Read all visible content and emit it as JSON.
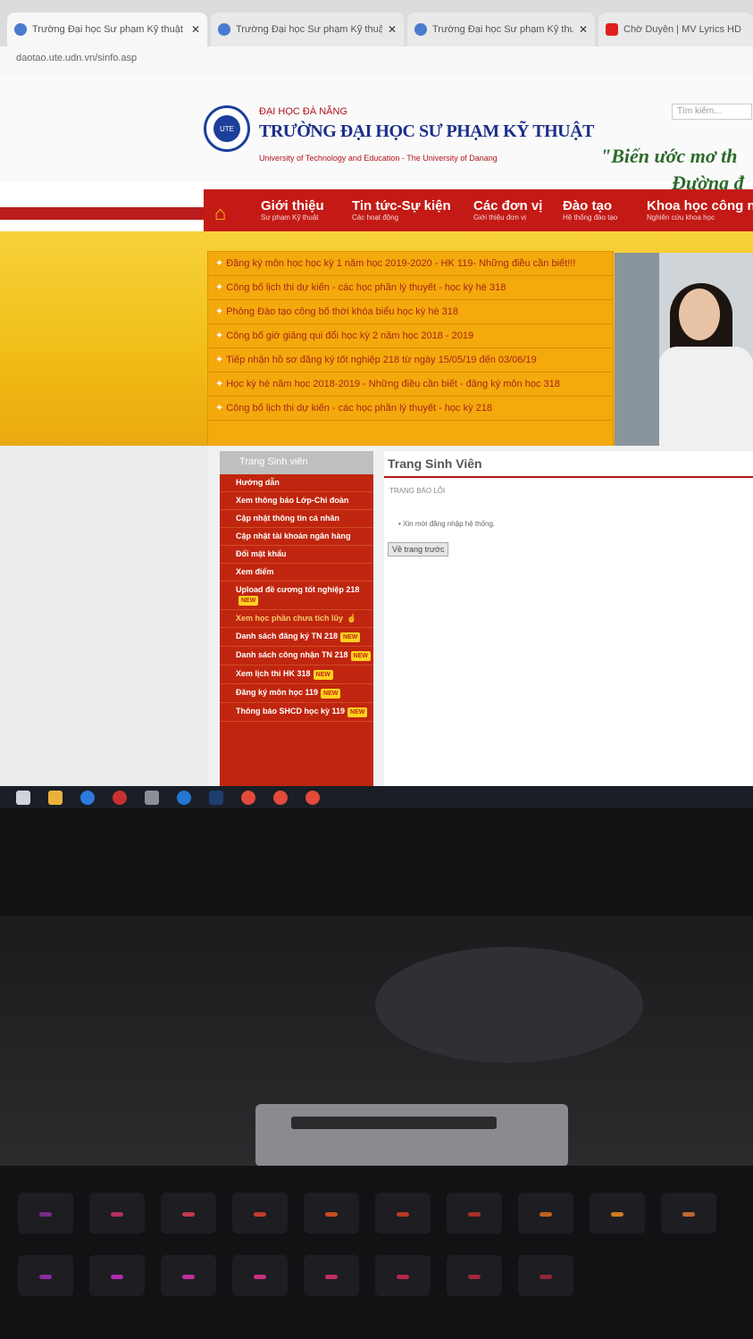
{
  "browser": {
    "tabs": [
      {
        "title": "Trường Đại học Sư phạm Kỹ thuật",
        "active": true
      },
      {
        "title": "Trường Đại học Sư phạm Kỹ thuật",
        "active": false
      },
      {
        "title": "Trường Đại học Sư phạm Kỹ thuật",
        "active": false
      },
      {
        "title": "Chờ Duyên | MV Lyrics HD",
        "active": false
      }
    ],
    "close_glyph": "✕",
    "address": "daotao.ute.udn.vn/sinfo.asp"
  },
  "header": {
    "org_top": "ĐẠI HỌC ĐÀ NẴNG",
    "org_name": "TRƯỜNG ĐẠI HỌC SƯ PHẠM KỸ THUẬT",
    "org_sub": "University of Technology and Education - The University of Danang",
    "search_placeholder": "Tìm kiếm...",
    "slogan_line1": "\"Biến ước mơ th",
    "slogan_line2": "Đường đ"
  },
  "nav": [
    {
      "label": "Giới thiệu",
      "sub": "Sư phạm Kỹ thuật"
    },
    {
      "label": "Tin tức-Sự kiện",
      "sub": "Các hoạt động"
    },
    {
      "label": "Các đơn vị",
      "sub": "Giới thiệu đơn vị"
    },
    {
      "label": "Đào tạo",
      "sub": "Hệ thống đào tạo"
    },
    {
      "label": "Khoa học công ng",
      "sub": "Nghiên cứu khoa học"
    }
  ],
  "news": [
    "Đăng ký môn học học kỳ 1 năm học 2019-2020 - HK 119- Những điều cần biết!!!",
    "Công bố lịch thi dự kiến - các học phần lý thuyết - học kỳ hè 318",
    "Phòng Đào tạo công bố thời khóa biểu học kỳ hè 318",
    "Công bố giờ giảng qui đổi học kỳ 2 năm học 2018 - 2019",
    "Tiếp nhận hồ sơ đăng ký tốt nghiệp 218 từ ngày 15/05/19 đến 03/06/19",
    "Học kỳ hè năm học 2018-2019 - Những điều cần biết - đăng ký môn học 318",
    "Công bố lịch thi dự kiến - các học phần lý thuyết - học kỳ 218"
  ],
  "sidebar": {
    "title": "Trang Sinh viên",
    "items": [
      {
        "label": "Hướng dẫn",
        "badge": ""
      },
      {
        "label": "Xem thông báo Lớp-Chi đoàn",
        "badge": ""
      },
      {
        "label": "Cập nhật thông tin cá nhân",
        "badge": ""
      },
      {
        "label": "Cập nhật tài khoản ngân hàng",
        "badge": ""
      },
      {
        "label": "Đổi mật khẩu",
        "badge": ""
      },
      {
        "label": "Xem điểm",
        "badge": ""
      },
      {
        "label": "Upload đề cương tốt nghiệp 218",
        "badge": "NEW"
      },
      {
        "label": "Xem học phần chưa tích lũy",
        "badge": ""
      },
      {
        "label": "Danh sách đăng ký TN 218",
        "badge": "NEW"
      },
      {
        "label": "Danh sách công nhận TN 218",
        "badge": "NEW"
      },
      {
        "label": "Xem lịch thi HK 318",
        "badge": "NEW"
      },
      {
        "label": "Đăng ký môn học 119",
        "badge": "NEW"
      },
      {
        "label": "Thông báo SHCD học kỳ 119",
        "badge": "NEW"
      }
    ]
  },
  "main": {
    "title": "Trang Sinh Viên",
    "breadcrumb": "TRANG BÁO LỖI",
    "error": "Xin mời đăng nhập hệ thống.",
    "back_button": "Về trang trước"
  }
}
